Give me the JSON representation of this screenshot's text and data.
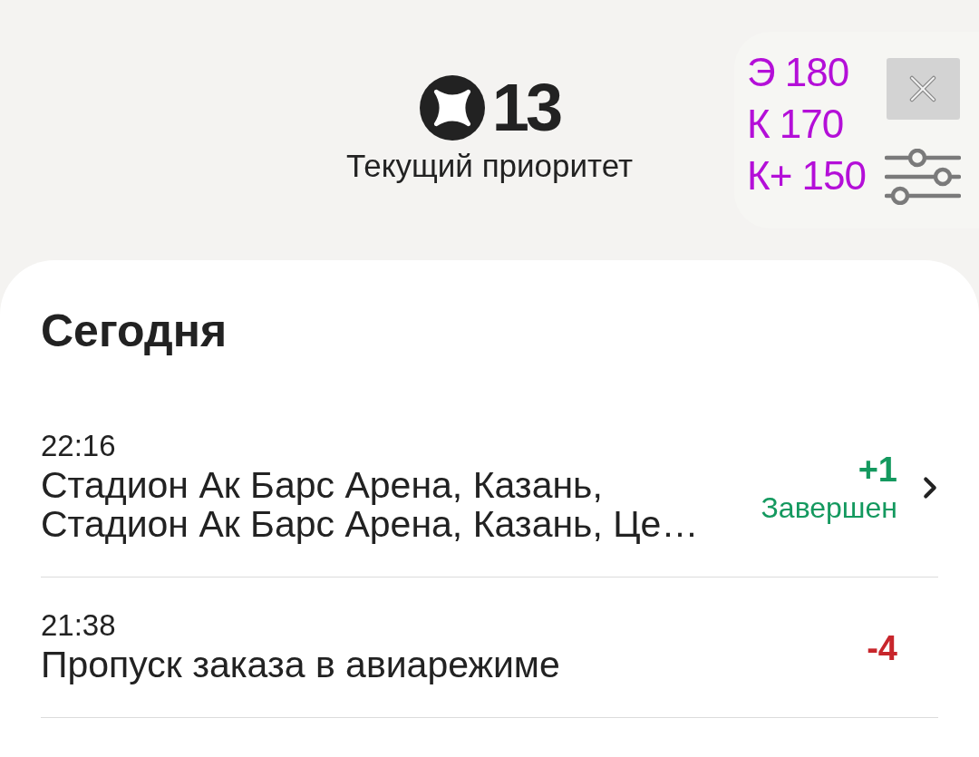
{
  "header": {
    "priority": "13",
    "label": "Текущий приоритет"
  },
  "overlay": {
    "lines": [
      "Э 180",
      "К 170",
      "К+ 150"
    ]
  },
  "section": {
    "title": "Сегодня",
    "rows": [
      {
        "time": "22:16",
        "title": "Стадион Ак Барс Арена, Казань, Стадион Ак Барс Арена, Казань, Це…",
        "points": "+1",
        "kind": "gain",
        "status": "Завершен",
        "chevron": true
      },
      {
        "time": "21:38",
        "title": "Пропуск заказа в авиарежиме",
        "points": "-4",
        "kind": "penalty",
        "chevron": false
      }
    ]
  }
}
